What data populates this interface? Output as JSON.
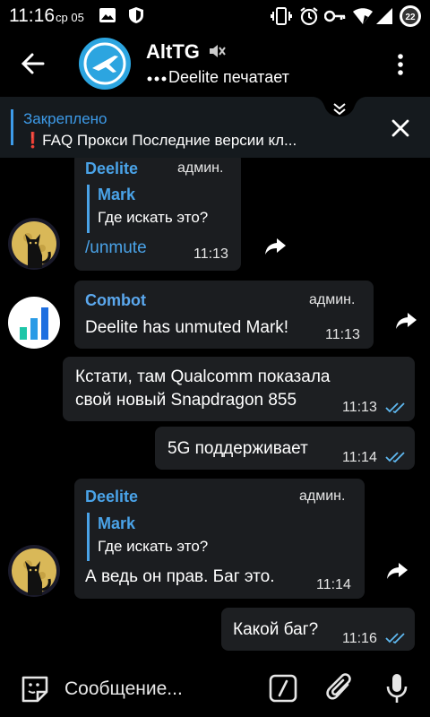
{
  "status_bar": {
    "time": "11:16",
    "date": "ср 05",
    "battery_percent": "22",
    "icons": [
      "image-icon",
      "shield-icon",
      "vibrate-icon",
      "alarm-icon",
      "key-icon",
      "wifi-icon",
      "signal-icon",
      "battery-icon"
    ]
  },
  "header": {
    "title": "AltTG",
    "subtitle": "Deelite печатает",
    "muted": true
  },
  "pinned": {
    "label": "Закреплено",
    "text": "❗FAQ   Прокси   Последние версии кл..."
  },
  "messages": [
    {
      "sender": "Deelite",
      "role": "админ.",
      "reply_name": "Mark",
      "reply_text": "Где искать это?",
      "text": "/unmute",
      "time": "11:13"
    },
    {
      "sender": "Combot",
      "role": "админ.",
      "text": "Deelite has unmuted Mark!",
      "time": "11:13"
    },
    {
      "line1": "Кстати, там Qualcomm показала",
      "line2": "свой новый Snapdragon 855",
      "time": "11:13",
      "read": true
    },
    {
      "text": "5G поддерживает",
      "time": "11:14",
      "read": true
    },
    {
      "sender": "Deelite",
      "role": "админ.",
      "reply_name": "Mark",
      "reply_text": "Где искать это?",
      "text": "А ведь он прав. Баг это.",
      "time": "11:14"
    },
    {
      "text": "Какой баг?",
      "time": "11:16",
      "read": true
    }
  ],
  "input": {
    "placeholder": "Сообщение..."
  },
  "colors": {
    "accent": "#4aa3e8",
    "bubble": "#1b1d20",
    "pinned_bg": "#151a1e",
    "read_ticks": "#5fb8f0"
  }
}
